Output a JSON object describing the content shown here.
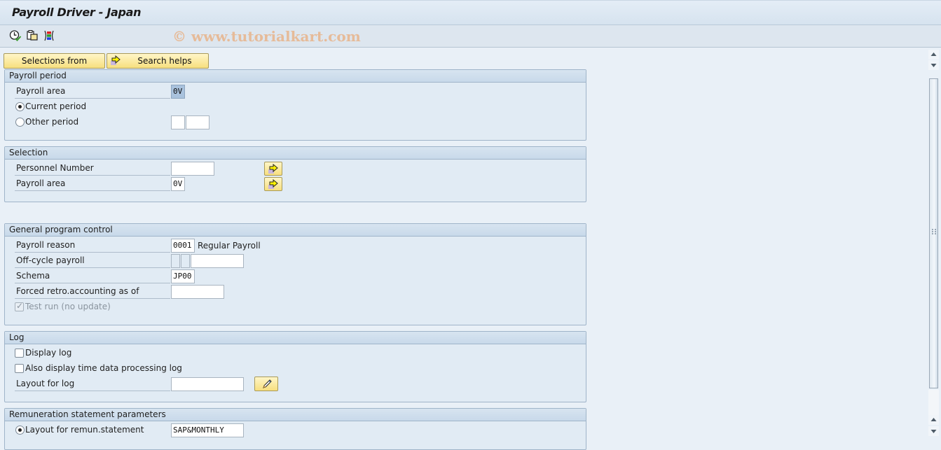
{
  "window": {
    "title": "Payroll Driver - Japan",
    "watermark": "© www.tutorialkart.com"
  },
  "toolbar": {
    "icons": [
      "execute-schedule-icon",
      "copy-variant-icon",
      "multiple-selection-icon"
    ]
  },
  "buttons": {
    "selections_from": "Selections from",
    "search_helps": "Search helps"
  },
  "payroll_period": {
    "header": "Payroll period",
    "payroll_area_label": "Payroll area",
    "payroll_area_value": "0V",
    "current_period_label": "Current period",
    "current_period_selected": true,
    "other_period_label": "Other period",
    "other_period_selected": false,
    "other_period_value1": "",
    "other_period_value2": ""
  },
  "selection": {
    "header": "Selection",
    "personnel_number_label": "Personnel Number",
    "personnel_number_value": "",
    "payroll_area_label": "Payroll area",
    "payroll_area_value": "0V"
  },
  "general_program_control": {
    "header": "General program control",
    "payroll_reason_label": "Payroll reason",
    "payroll_reason_value": "0001",
    "payroll_reason_desc": "Regular Payroll",
    "off_cycle_label": "Off-cycle payroll",
    "off_cycle_value": "",
    "schema_label": "Schema",
    "schema_value": "JP00",
    "forced_retro_label": "Forced retro.accounting as of",
    "forced_retro_value": "",
    "test_run_label": "Test run (no update)",
    "test_run_checked": true
  },
  "log": {
    "header": "Log",
    "display_log_label": "Display log",
    "display_log_checked": false,
    "time_data_log_label": "Also display time data processing log",
    "time_data_log_checked": false,
    "layout_label": "Layout for log",
    "layout_value": ""
  },
  "remuneration": {
    "header": "Remuneration statement parameters",
    "layout_label": "Layout for remun.statement",
    "layout_selected": true,
    "layout_value": "SAP&MONTHLY"
  },
  "colors": {
    "button_yellow": "#f7df7e",
    "group_bg": "#e1ebf4",
    "selected_field": "#a9c2dd",
    "watermark": "#e8b790"
  }
}
